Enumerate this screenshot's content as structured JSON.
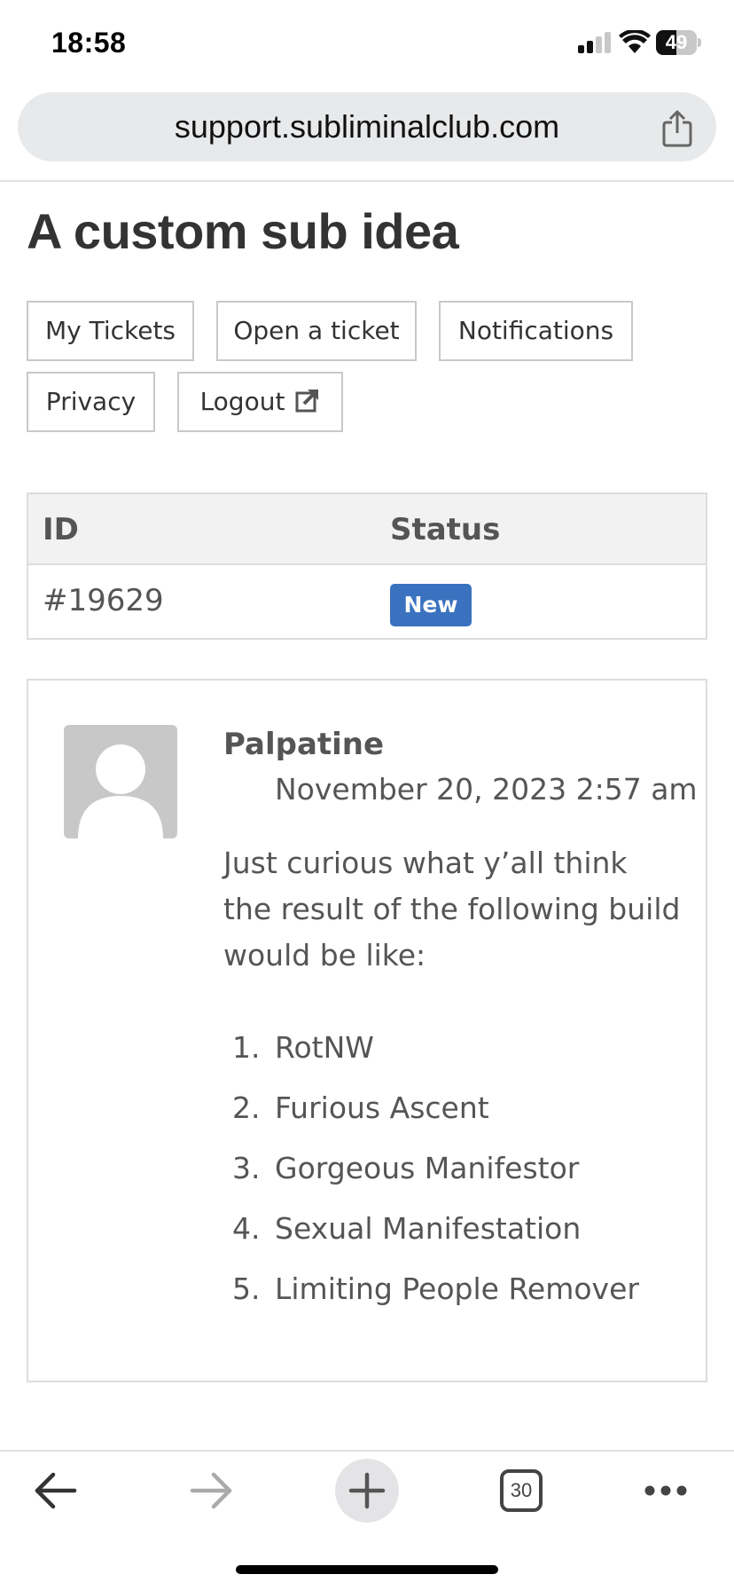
{
  "status_bar": {
    "time": "18:58",
    "battery": "49",
    "battery_level_percent": 49
  },
  "browser": {
    "url": "support.subliminalclub.com",
    "tab_count": "30"
  },
  "page": {
    "title": "A custom sub idea",
    "nav": [
      {
        "label": "My Tickets"
      },
      {
        "label": "Open a ticket"
      },
      {
        "label": "Notifications"
      },
      {
        "label": "Privacy"
      },
      {
        "label": "Logout",
        "icon": "external-link-icon"
      }
    ],
    "table": {
      "headers": [
        "ID",
        "Status"
      ],
      "rows": [
        {
          "id": "#19629",
          "status": "New"
        }
      ],
      "status_color": "#3a72c0"
    },
    "message": {
      "author": "Palpatine",
      "date": "November 20, 2023 2:57 am",
      "body": "Just curious what y’all think the result of the following build would be like:",
      "list": [
        {
          "num": "1.",
          "text": "RotNW"
        },
        {
          "num": "2.",
          "text": "Furious Ascent"
        },
        {
          "num": "3.",
          "text": "Gorgeous Manifestor"
        },
        {
          "num": "4.",
          "text": "Sexual Manifestation"
        },
        {
          "num": "5.",
          "text": "Limiting People Remover"
        }
      ]
    }
  },
  "icons": {
    "back": "arrow-left-icon",
    "forward": "arrow-right-icon",
    "new_tab": "plus-icon",
    "tabs": "tabs-icon",
    "more": "more-icon",
    "share": "share-icon"
  }
}
